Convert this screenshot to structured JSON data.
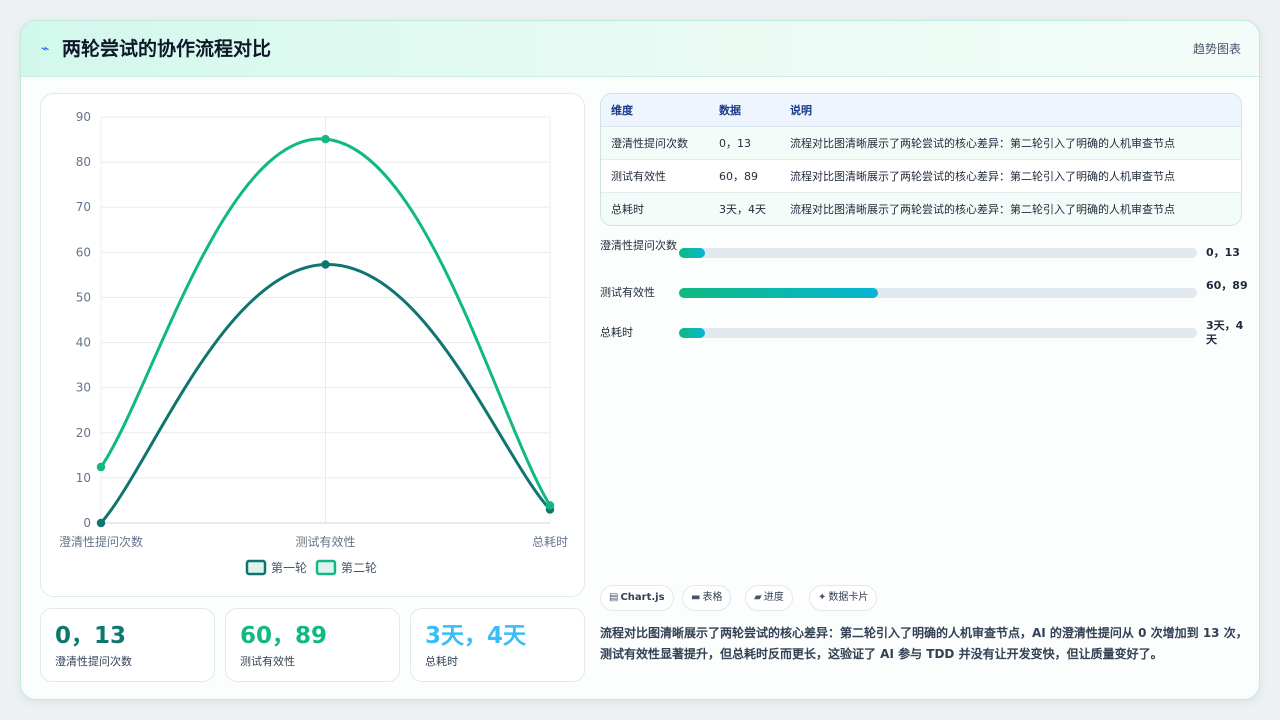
{
  "header": {
    "title": "两轮尝试的协作流程对比",
    "tag": "趋势图表",
    "icon": "trend-line-icon"
  },
  "chart_data": {
    "type": "line",
    "categories": [
      "澄清性提问次数",
      "测试有效性",
      "总耗时"
    ],
    "series": [
      {
        "name": "第一轮",
        "values": [
          0,
          57.3,
          3
        ],
        "color": "#0f766e"
      },
      {
        "name": "第二轮",
        "values": [
          12.4,
          85.1,
          3.9
        ],
        "color": "#10b981"
      }
    ],
    "ylim": [
      0,
      90
    ],
    "yticks": [
      0,
      10,
      20,
      30,
      40,
      50,
      60,
      70,
      80,
      90
    ],
    "grid": true,
    "legend": "bottom"
  },
  "stats": [
    {
      "value": "0，13",
      "label": "澄清性提问次数",
      "color": "#0f766e"
    },
    {
      "value": "60，89",
      "label": "测试有效性",
      "color": "#10b981"
    },
    {
      "value": "3天，4天",
      "label": "总耗时",
      "color": "#38bdf8"
    }
  ],
  "table": {
    "headers": [
      "维度",
      "数据",
      "说明"
    ],
    "rows": [
      [
        "澄清性提问次数",
        "0，13",
        "流程对比图清晰展示了两轮尝试的核心差异：第二轮引入了明确的人机审查节点"
      ],
      [
        "测试有效性",
        "60，89",
        "流程对比图清晰展示了两轮尝试的核心差异：第二轮引入了明确的人机审查节点"
      ],
      [
        "总耗时",
        "3天，4天",
        "流程对比图清晰展示了两轮尝试的核心差异：第二轮引入了明确的人机审查节点"
      ]
    ]
  },
  "progress": [
    {
      "label": "澄清性提问次数",
      "value": "0，13",
      "fraction": 0.05
    },
    {
      "label": "测试有效性",
      "value": "60，89",
      "fraction": 0.385
    },
    {
      "label": "总耗时",
      "value": "3天，4天",
      "fraction": 0.05
    }
  ],
  "chips": [
    {
      "icon": "chart-icon",
      "label": "Chart.js"
    },
    {
      "icon": "table-icon",
      "label": "表格"
    },
    {
      "icon": "progress-icon",
      "label": "进度"
    },
    {
      "icon": "sparkle-icon",
      "label": "数据卡片"
    }
  ],
  "summary": "流程对比图清晰展示了两轮尝试的核心差异：第二轮引入了明确的人机审查节点，AI 的澄清性提问从 0 次增加到 13 次，测试有效性显著提升，但总耗时反而更长，这验证了 AI 参与 TDD 并没有让开发变快，但让质量变好了。"
}
